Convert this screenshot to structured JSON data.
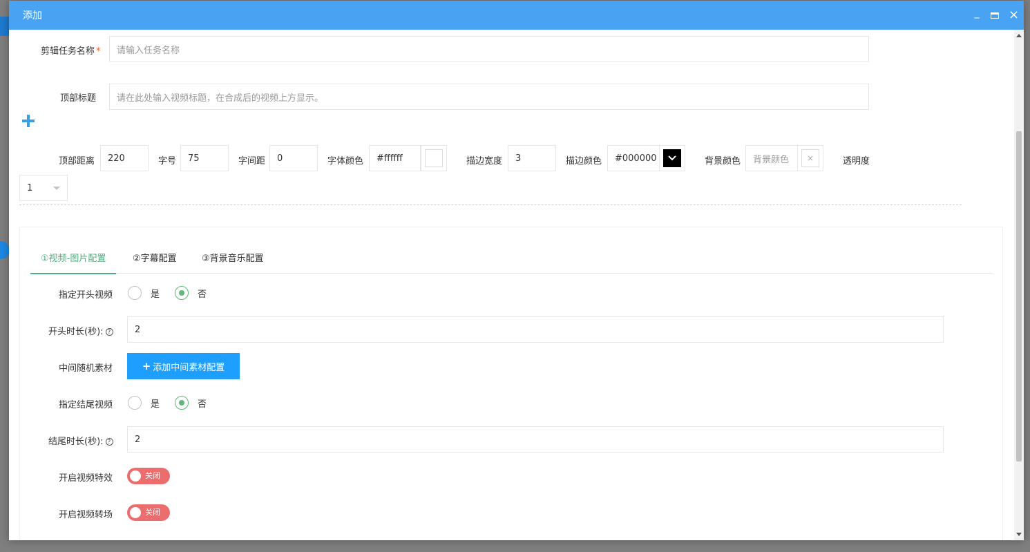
{
  "dialog": {
    "title": "添加",
    "minimize_label": "_",
    "close_label": "×"
  },
  "form": {
    "task_name": {
      "label": "剪辑任务名称",
      "required_mark": "*",
      "placeholder": "请输入任务名称"
    },
    "top_title": {
      "label": "顶部标题",
      "placeholder": "请在此处输入视频标题，在合成后的视频上方显示。"
    },
    "title_style": {
      "top_distance": {
        "label": "顶部距离",
        "value": "220"
      },
      "font_size": {
        "label": "字号",
        "value": "75"
      },
      "letter_spacing": {
        "label": "字间距",
        "value": "0"
      },
      "font_color": {
        "label": "字体颜色",
        "value": "#ffffff",
        "swatch": "#ffffff"
      },
      "stroke_width": {
        "label": "描边宽度",
        "value": "3"
      },
      "stroke_color": {
        "label": "描边颜色",
        "value": "#000000",
        "swatch": "#000000"
      },
      "bg_color": {
        "label": "背景颜色",
        "placeholder": "背景颜色",
        "clear_icon": "×"
      },
      "opacity": {
        "label": "透明度",
        "value": "1"
      }
    }
  },
  "tabs": [
    {
      "label": "①视频-图片配置",
      "active": true
    },
    {
      "label": "②字幕配置",
      "active": false
    },
    {
      "label": "③背景音乐配置",
      "active": false
    }
  ],
  "video_config": {
    "intro_video": {
      "label": "指定开头视频",
      "yes": "是",
      "no": "否",
      "selected": "no"
    },
    "intro_duration": {
      "label": "开头时长(秒):",
      "help": "?",
      "value": "2"
    },
    "middle_material": {
      "label": "中间随机素材",
      "button": "添加中间素材配置",
      "button_icon": "+"
    },
    "outro_video": {
      "label": "指定结尾视频",
      "yes": "是",
      "no": "否",
      "selected": "no"
    },
    "outro_duration": {
      "label": "结尾时长(秒):",
      "help": "?",
      "value": "2"
    },
    "effects": {
      "label": "开启视频特效",
      "state": "关闭"
    },
    "transitions": {
      "label": "开启视频转场",
      "state": "关闭"
    }
  },
  "colors": {
    "titlebar": "#4aa3f2",
    "accent_green": "#5fb878",
    "primary_blue": "#1e9fff",
    "switch_off": "#ec6d6d"
  }
}
